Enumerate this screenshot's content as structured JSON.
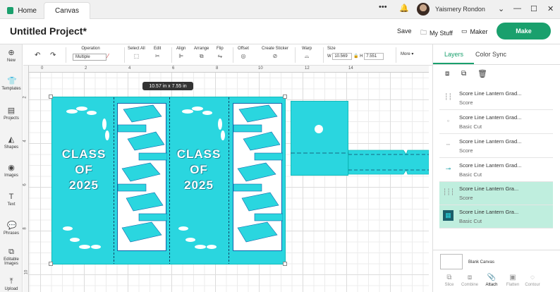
{
  "tabs": {
    "home": "Home",
    "canvas": "Canvas"
  },
  "window": {
    "more": "•••",
    "bell_icon": "bell-icon",
    "user": "Yaismery Rondon",
    "minimize": "—",
    "maximize": "☐",
    "close": "✕"
  },
  "header": {
    "title": "Untitled Project*",
    "save": "Save",
    "my_stuff": "My Stuff",
    "maker": "Maker",
    "make": "Make"
  },
  "rail": [
    {
      "label": "New",
      "icon": "plus-icon"
    },
    {
      "label": "Templates",
      "icon": "shirt-icon"
    },
    {
      "label": "Projects",
      "icon": "projects-icon"
    },
    {
      "label": "Shapes",
      "icon": "shapes-icon"
    },
    {
      "label": "Images",
      "icon": "bulb-icon"
    },
    {
      "label": "Text",
      "icon": "text-icon"
    },
    {
      "label": "Phrases",
      "icon": "speech-icon"
    },
    {
      "label": "Editable Images",
      "icon": "edit-image-icon"
    },
    {
      "label": "Upload",
      "icon": "upload-icon"
    }
  ],
  "toolbar": {
    "operation_label": "Operation",
    "operation_value": "Multiple",
    "select_all": "Select All",
    "edit": "Edit",
    "align": "Align",
    "arrange": "Arrange",
    "flip": "Flip",
    "offset": "Offset",
    "create_sticker": "Create Sticker",
    "warp": "Warp",
    "size": "Size",
    "w_label": "W",
    "w_value": "10.569",
    "h_label": "H",
    "h_value": "7.551",
    "more": "More"
  },
  "ruler": {
    "top": [
      "0",
      "2",
      "4",
      "6",
      "8",
      "10",
      "12",
      "14"
    ],
    "left": [
      "2",
      "4",
      "6",
      "8",
      "10"
    ]
  },
  "canvas": {
    "dimension_tip": "10.57  in x 7.55  in",
    "class_line1": "CLASS",
    "class_line2": "OF",
    "class_line3": "2025"
  },
  "panel": {
    "tab_layers": "Layers",
    "tab_color_sync": "Color Sync",
    "layers": [
      {
        "name": "Score Line Lantern Grad...",
        "type": "Score",
        "selected": false
      },
      {
        "name": "Score Line Lantern Grad...",
        "type": "Basic Cut",
        "selected": false
      },
      {
        "name": "Score Line Lantern Grad...",
        "type": "Score",
        "selected": false
      },
      {
        "name": "Score Line Lantern Grad...",
        "type": "Basic Cut",
        "selected": false
      },
      {
        "name": "Score Line Lantern Gra...",
        "type": "Score",
        "selected": true
      },
      {
        "name": "Score Line Lantern Gra...",
        "type": "Basic Cut",
        "selected": true
      }
    ],
    "blank_canvas": "Blank Canvas",
    "actions": [
      "Slice",
      "Combine",
      "Attach",
      "Flatten",
      "Contour"
    ]
  },
  "colors": {
    "brand": "#1aa06d",
    "design": "#2ad6df",
    "selected_row": "#bfeede"
  }
}
